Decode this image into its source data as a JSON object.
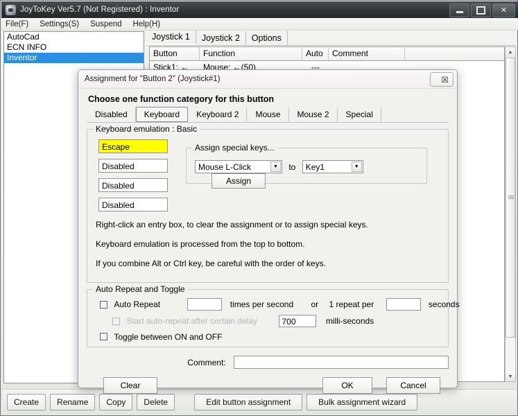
{
  "window": {
    "title": "JoyToKey Ver5.7 (Not Registered) : Inventor",
    "icon": "joystick-app-icon",
    "controls": {
      "minimize": "minimize-icon",
      "maximize": "maximize-icon",
      "close": "✕"
    }
  },
  "menu": [
    {
      "label": "File(F)"
    },
    {
      "label": "Settings(S)"
    },
    {
      "label": "Suspend"
    },
    {
      "label": "Help(H)"
    }
  ],
  "sidebar": {
    "items": [
      {
        "label": "AutoCad",
        "selected": false
      },
      {
        "label": "ECN INFO",
        "selected": false
      },
      {
        "label": "Inventor",
        "selected": true
      }
    ]
  },
  "main": {
    "tabs": [
      {
        "label": "Joystick 1",
        "active": true
      },
      {
        "label": "Joystick 2",
        "active": false
      },
      {
        "label": "Options",
        "active": false
      }
    ],
    "grid": {
      "columns": [
        "Button",
        "Function",
        "Auto",
        "Comment",
        ""
      ],
      "rows": [
        {
          "button": "Stick1: ←",
          "function": "Mouse: ←(50)",
          "auto": "---",
          "comment": ""
        }
      ]
    },
    "scrollbar": {
      "up": "▲",
      "down": "▼"
    }
  },
  "bottom_toolbar": {
    "left_buttons": [
      "Create",
      "Rename",
      "Copy",
      "Delete"
    ],
    "right_buttons": [
      "Edit button assignment",
      "Bulk assignment wizard"
    ]
  },
  "dialog": {
    "title": "Assignment for \"Button 2\" (Joystick#1)",
    "close_icon": "☒",
    "heading": "Choose one function category for this button",
    "category_tabs": [
      {
        "label": "Disabled",
        "active": false
      },
      {
        "label": "Keyboard",
        "active": true
      },
      {
        "label": "Keyboard 2",
        "active": false
      },
      {
        "label": "Mouse",
        "active": false
      },
      {
        "label": "Mouse 2",
        "active": false
      },
      {
        "label": "Special",
        "active": false
      }
    ],
    "keyboard_group": {
      "legend": "Keyboard emulation : Basic",
      "entries": [
        {
          "value": "Escape",
          "highlighted": true
        },
        {
          "value": "Disabled",
          "highlighted": false
        },
        {
          "value": "Disabled",
          "highlighted": false
        },
        {
          "value": "Disabled",
          "highlighted": false
        }
      ],
      "special_keys": {
        "legend": "Assign special keys...",
        "source_value": "Mouse L-Click",
        "to_label": "to",
        "target_value": "Key1",
        "assign_label": "Assign",
        "dropdown_icon": "▼"
      },
      "hints": [
        "Right-click an entry box, to clear the assignment or to assign special keys.",
        "Keyboard emulation is processed from the top to bottom.",
        "If you combine Alt or Ctrl key, be careful with the order of keys."
      ]
    },
    "repeat_group": {
      "legend": "Auto Repeat and Toggle",
      "auto_repeat": {
        "label": "Auto Repeat",
        "checked": false,
        "rate_value": "",
        "rate_suffix": "times per second",
        "or_label": "or",
        "per_label": "1 repeat per",
        "seconds_value": "",
        "seconds_suffix": "seconds"
      },
      "delay": {
        "label": "Start auto-repeat after certain delay",
        "checked": false,
        "enabled": false,
        "value": "700",
        "suffix": "milli-seconds"
      },
      "toggle": {
        "label": "Toggle between ON and OFF",
        "checked": false
      }
    },
    "comment": {
      "label": "Comment:",
      "value": ""
    },
    "buttons": {
      "clear": "Clear",
      "ok": "OK",
      "cancel": "Cancel"
    }
  },
  "colors": {
    "highlight_yellow": "#ffff00",
    "selection_blue": "#2a8fe0",
    "titlebar_dark": "#2f3235"
  }
}
